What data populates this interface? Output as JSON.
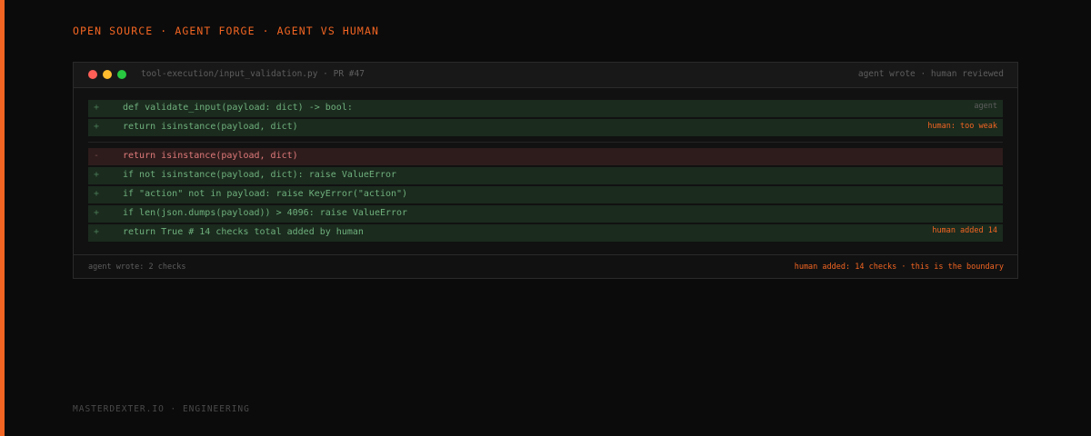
{
  "accent_color": "#f26522",
  "eyebrow": "OPEN SOURCE · AGENT FORGE · AGENT VS HUMAN",
  "window": {
    "controls": [
      "close-icon",
      "minimize-icon",
      "maximize-icon"
    ],
    "file_title": "tool-execution/input_validation.py · PR #47",
    "meta_right": "agent wrote · human reviewed"
  },
  "diff": [
    {
      "type": "add",
      "sign": "+",
      "code": "def validate_input(payload: dict) -> bool:",
      "note": "agent"
    },
    {
      "type": "add",
      "sign": "+",
      "code": "return isinstance(payload, dict)",
      "note": "human: too weak"
    },
    {
      "type": "del",
      "sign": "-",
      "code": "return isinstance(payload, dict)",
      "note": ""
    },
    {
      "type": "add",
      "sign": "+",
      "code": "if not isinstance(payload, dict): raise ValueError",
      "note": ""
    },
    {
      "type": "add",
      "sign": "+",
      "code": "if \"action\" not in payload: raise KeyError(\"action\")",
      "note": ""
    },
    {
      "type": "add",
      "sign": "+",
      "code": "if len(json.dumps(payload)) > 4096: raise ValueError",
      "note": ""
    },
    {
      "type": "add",
      "sign": "+",
      "code": "return True # 14 checks total added by human",
      "note": "human added 14"
    }
  ],
  "footer": {
    "left": "agent wrote: 2 checks",
    "right": "human added: 14 checks · this is the boundary"
  },
  "credit": "MASTERDEXTER.IO · ENGINEERING"
}
